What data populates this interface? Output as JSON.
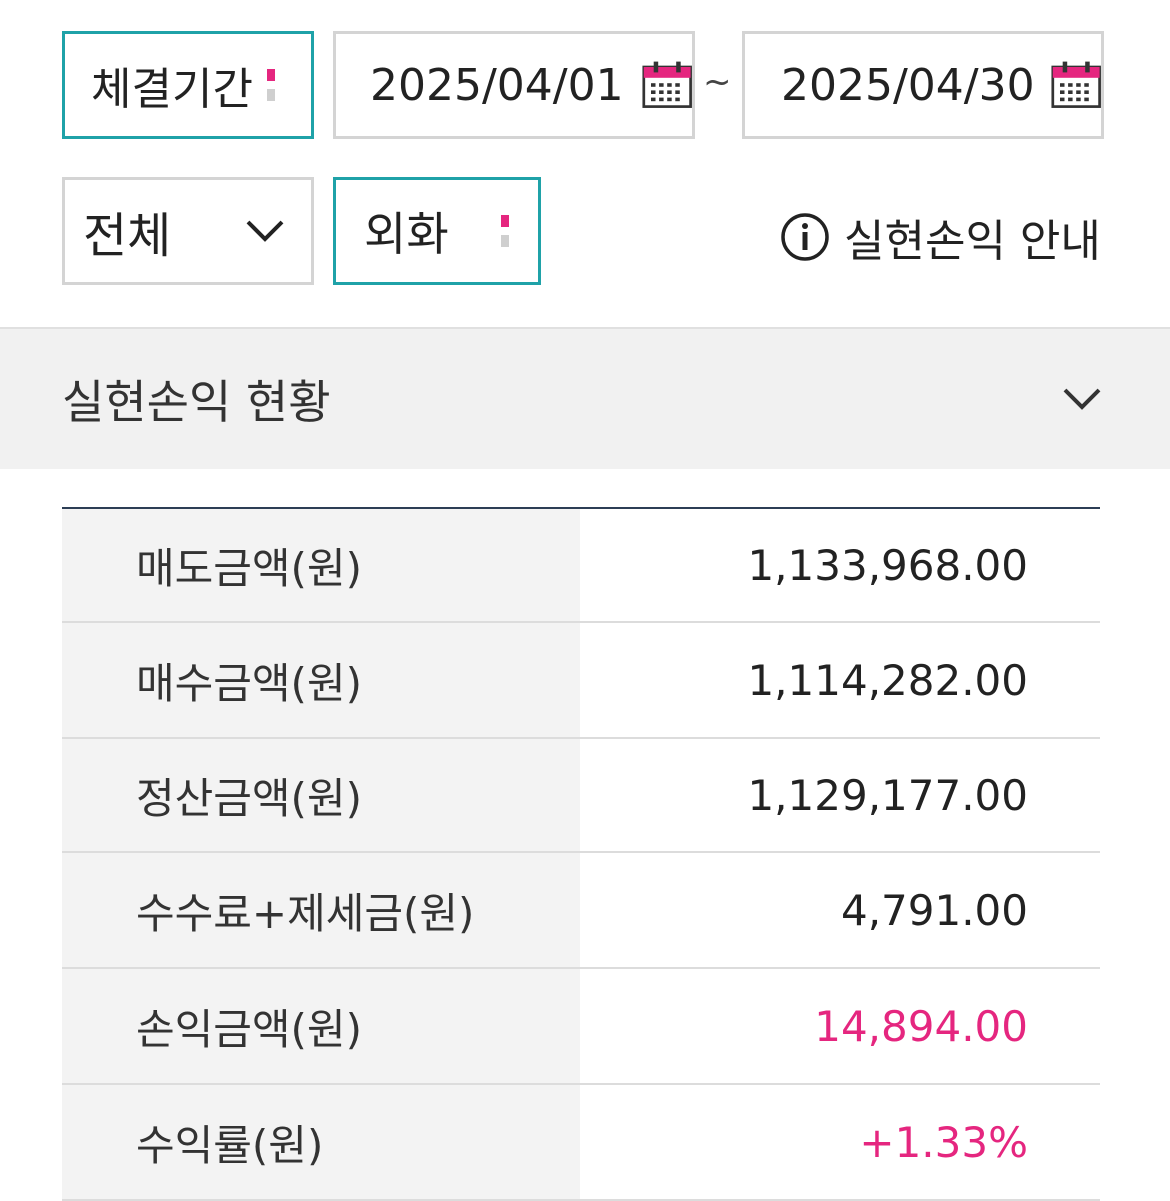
{
  "filters": {
    "period_label": "체결기간",
    "start_date": "2025/04/01",
    "separator": "~",
    "end_date": "2025/04/30",
    "type_select": "전체",
    "currency_select": "외화",
    "info_link": "실현손익 안내",
    "icons": [
      "calendar-icon",
      "chevron-down-icon",
      "info-icon"
    ]
  },
  "section": {
    "title": "실현손익 현황"
  },
  "rows": [
    {
      "label": "매도금액(원)",
      "value": "1,133,968.00"
    },
    {
      "label": "매수금액(원)",
      "value": "1,114,282.00"
    },
    {
      "label": "정산금액(원)",
      "value": "1,129,177.00"
    },
    {
      "label": "수수료+제세금(원)",
      "value": "4,791.00"
    },
    {
      "label": "손익금액(원)",
      "value": "14,894.00"
    },
    {
      "label": "수익률(원)",
      "value": "+1.33%"
    }
  ],
  "colors": {
    "accent_teal": "#1fa2a8",
    "accent_pink": "#e5267f",
    "positive": "#e5267f",
    "header_line": "#2c3e55"
  }
}
